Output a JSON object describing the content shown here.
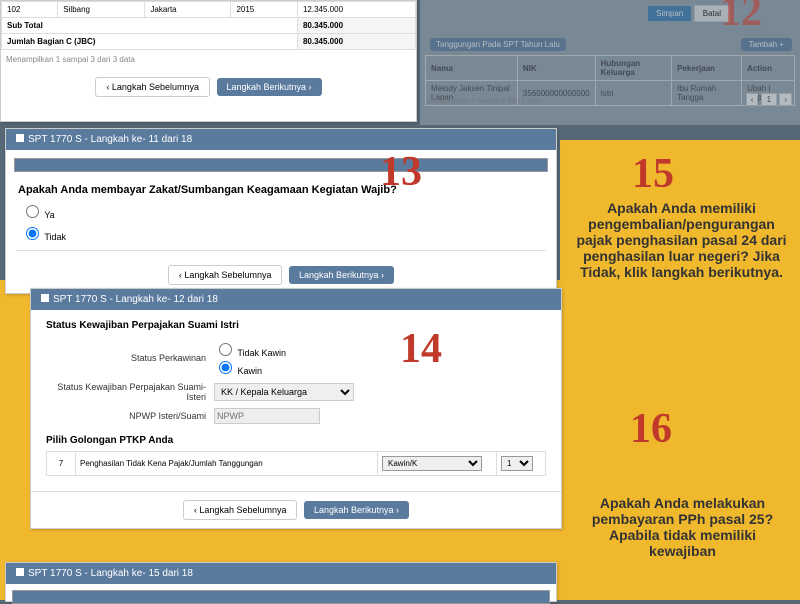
{
  "top": {
    "row": {
      "no": "102",
      "col1": "Silbang",
      "col2": "Jakarta",
      "col3": "2015",
      "amt": "12.345.000"
    },
    "subtotal_lbl": "Sub Total",
    "subtotal_amt": "80.345.000",
    "jbc_lbl": "Jumlah Bagian C (JBC)",
    "jbc_amt": "80.345.000",
    "showing": "Menampilkan 1 sampai 3 dari 3 data"
  },
  "nav": {
    "prev": "‹ Langkah Sebelumnya",
    "next": "Langkah Berikutnya ›"
  },
  "p12": {
    "num": "12",
    "btn_save": "Simpan",
    "btn_cancel": "Batal",
    "tanggungan_title": "Tanggungan Pada SPT Tahun Lalu",
    "tambah": "Tambah +",
    "th1": "Nama",
    "th2": "NIK",
    "th3": "Hubungan Keluarga",
    "th4": "Pekerjaan",
    "th5": "Action",
    "r_name": "Melody Jaksen Tinipal Lapan",
    "r_nik": "356000000000000",
    "r_hub": "Istri",
    "r_job": "Ibu Rumah Tangga",
    "r_act": "Ubah | Hapus",
    "showing": "Menampilkan 1 sampai 1 dari 1 data",
    "pg": "1"
  },
  "p13": {
    "num": "13",
    "hdr": "SPT 1770 S - Langkah ke- 11 dari 18",
    "q": "Apakah Anda membayar Zakat/Sumbangan Keagamaan Kegiatan Wajib?",
    "ya": "Ya",
    "tidak": "Tidak"
  },
  "p14": {
    "num": "14",
    "hdr": "SPT 1770 S - Langkah ke- 12 dari 18",
    "sec1": "Status Kewajiban Perpajakan Suami Istri",
    "lbl_perkawinan": "Status Perkawinan",
    "opt_tk": "Tidak Kawin",
    "opt_k": "Kawin",
    "lbl_kwj": "Status Kewajiban Perpajakan Suami-Isteri",
    "sel_kk": "KK / Kepala Keluarga",
    "lbl_npwp": "NPWP Isteri/Suami",
    "npwp_ph": "NPWP",
    "sec2": "Pilih Golongan PTKP Anda",
    "ptkp_no": "7",
    "ptkp_lbl": "Penghasilan Tidak Kena Pajak/Jumlah Tanggungan",
    "ptkp_sel": "Kawin/K",
    "ptkp_ct": "1"
  },
  "p15": {
    "num": "15",
    "q": "Apakah Anda memiliki pengembalian/pengurangan pajak penghasilan pasal 24 dari penghasilan luar negeri? Jika Tidak, klik langkah berikutnya."
  },
  "p16": {
    "num": "16",
    "q": "Apakah Anda melakukan pembayaran PPh pasal 25? Apabila tidak memiliki kewajiban"
  },
  "p17": {
    "hdr": "SPT 1770 S - Langkah ke- 15 dari 18"
  }
}
